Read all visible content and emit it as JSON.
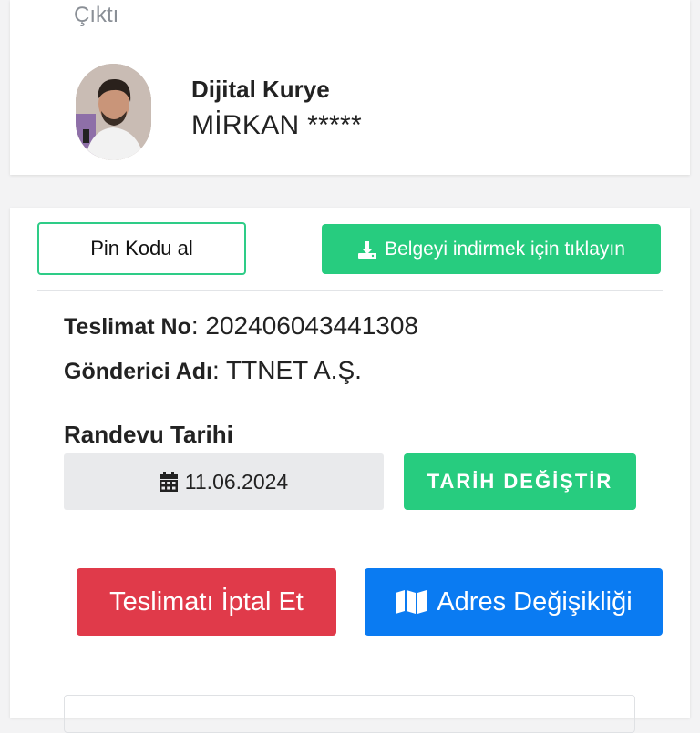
{
  "header": {
    "section_title": "Çıktı"
  },
  "courier": {
    "label": "Dijital Kurye",
    "name": "MİRKAN *****"
  },
  "actions": {
    "pin_label": "Pin Kodu al",
    "download_label": "Belgeyi indirmek için tıklayın"
  },
  "delivery": {
    "no_label": "Teslimat No",
    "no_value": "202406043441308",
    "sender_label": "Gönderici Adı",
    "sender_value": "TTNET A.Ş."
  },
  "appointment": {
    "label": "Randevu Tarihi",
    "date": "11.06.2024",
    "change_label": "TARİH DEĞİŞTİR"
  },
  "buttons": {
    "cancel_label": "Teslimatı İptal Et",
    "address_label": "Adres Değişikliği"
  },
  "colors": {
    "green": "#27cc7f",
    "red": "#e03a4a",
    "blue": "#0a7bf2",
    "muted_text": "#8a8f96"
  },
  "icons": {
    "download": "download-icon",
    "calendar": "calendar-icon",
    "map": "map-icon",
    "avatar": "courier-avatar"
  }
}
